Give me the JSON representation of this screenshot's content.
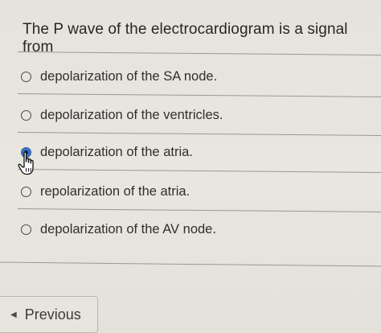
{
  "question": {
    "text": "The P wave of the electrocardiogram is a signal from"
  },
  "options": [
    {
      "label": "depolarization of the SA node.",
      "selected": false
    },
    {
      "label": "depolarization of the ventricles.",
      "selected": false
    },
    {
      "label": "depolarization of the atria.",
      "selected": true
    },
    {
      "label": "repolarization of the atria.",
      "selected": false
    },
    {
      "label": "depolarization of the AV node.",
      "selected": false
    }
  ],
  "navigation": {
    "previous_label": "Previous",
    "previous_icon": "chevron-left-icon"
  },
  "colors": {
    "selected_radio": "#3b72c9",
    "background": "#e8e5de"
  }
}
